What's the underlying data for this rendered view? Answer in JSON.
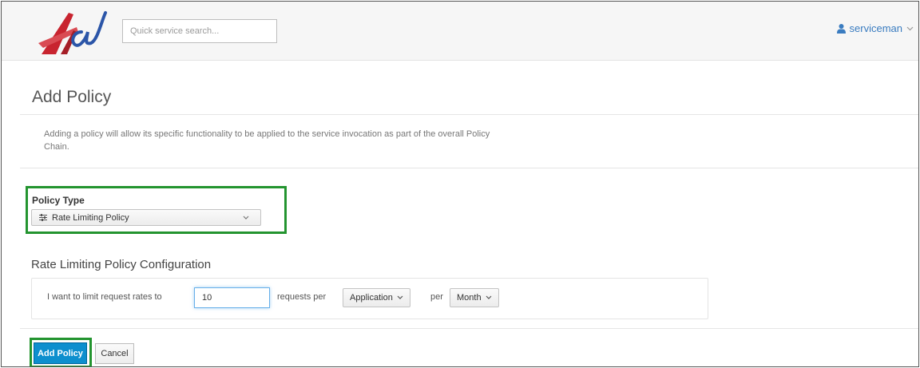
{
  "header": {
    "search_placeholder": "Quick service search...",
    "username": "serviceman",
    "user_icon": "user-icon",
    "accent_color": "#3a7cc0"
  },
  "page": {
    "title": "Add Policy",
    "description": "Adding a policy will allow its specific functionality to be applied to the service invocation as part of the overall Policy Chain."
  },
  "policy_type": {
    "label": "Policy Type",
    "selected": "Rate Limiting Policy",
    "icon": "sliders-icon"
  },
  "config": {
    "title": "Rate Limiting Policy Configuration",
    "text_before": "I want to limit request rates to",
    "rate_value": "10",
    "text_requests_per": "requests per",
    "granularity": "Application",
    "text_per": "per",
    "period": "Month"
  },
  "actions": {
    "add_label": "Add Policy",
    "cancel_label": "Cancel",
    "primary_color": "#0d8fce",
    "highlight_color": "#23942f"
  }
}
